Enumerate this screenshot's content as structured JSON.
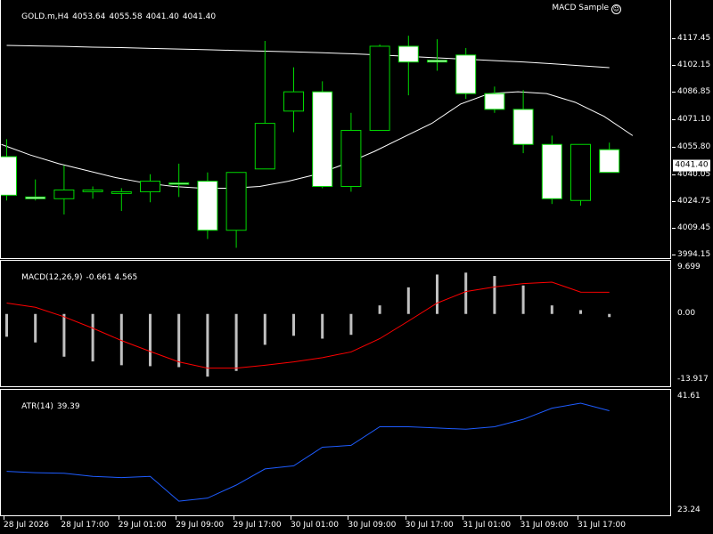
{
  "chart_data": [
    {
      "type": "candlestick",
      "header": {
        "symbol": "GOLD.m,H4",
        "open": "4053.64",
        "high": "4055.58",
        "low": "4041.40",
        "close": "4041.40"
      },
      "expert_name": "MACD Sample",
      "expert_icon": "smiley-icon",
      "current_price": "4041.40",
      "ylim": [
        3994.15,
        4127.2
      ],
      "yticks": [
        "4117.45",
        "4102.15",
        "4086.85",
        "4071.10",
        "4055.80",
        "4040.05",
        "4024.75",
        "4009.45",
        "3994.15"
      ],
      "candles": [
        {
          "o": 4050.0,
          "h": 4060.0,
          "l": 4025.0,
          "c": 4028.0
        },
        {
          "o": 4027.0,
          "h": 4037.0,
          "l": 4025.0,
          "c": 4026.0
        },
        {
          "o": 4026.0,
          "h": 4045.0,
          "l": 4017.0,
          "c": 4031.0
        },
        {
          "o": 4030.0,
          "h": 4033.0,
          "l": 4026.0,
          "c": 4031.0
        },
        {
          "o": 4029.0,
          "h": 4032.0,
          "l": 4019.0,
          "c": 4030.0
        },
        {
          "o": 4030.0,
          "h": 4040.0,
          "l": 4024.0,
          "c": 4036.0
        },
        {
          "o": 4035.0,
          "h": 4046.0,
          "l": 4027.0,
          "c": 4035.0
        },
        {
          "o": 4036.0,
          "h": 4041.0,
          "l": 4003.0,
          "c": 4008.0
        },
        {
          "o": 4008.0,
          "h": 4041.0,
          "l": 3998.0,
          "c": 4041.0
        },
        {
          "o": 4043.0,
          "h": 4116.0,
          "l": 4043.0,
          "c": 4069.0
        },
        {
          "o": 4076.0,
          "h": 4101.0,
          "l": 4064.0,
          "c": 4087.0
        },
        {
          "o": 4087.0,
          "h": 4093.0,
          "l": 4032.0,
          "c": 4033.0
        },
        {
          "o": 4033.0,
          "h": 4075.0,
          "l": 4030.0,
          "c": 4065.0
        },
        {
          "o": 4065.0,
          "h": 4114.0,
          "l": 4065.0,
          "c": 4113.0
        },
        {
          "o": 4113.0,
          "h": 4119.0,
          "l": 4085.0,
          "c": 4104.0
        },
        {
          "o": 4105.0,
          "h": 4117.0,
          "l": 4099.0,
          "c": 4104.0
        },
        {
          "o": 4108.0,
          "h": 4112.0,
          "l": 4083.0,
          "c": 4086.0
        },
        {
          "o": 4086.0,
          "h": 4090.0,
          "l": 4075.0,
          "c": 4077.0
        },
        {
          "o": 4077.0,
          "h": 4088.0,
          "l": 4052.0,
          "c": 4057.0
        },
        {
          "o": 4057.0,
          "h": 4062.0,
          "l": 4023.0,
          "c": 4026.0
        },
        {
          "o": 4025.0,
          "h": 4057.0,
          "l": 4022.0,
          "c": 4057.0
        },
        {
          "o": 4054.0,
          "h": 4058.0,
          "l": 4041.0,
          "c": 4041.0
        }
      ],
      "ma_slow": [
        4113.5,
        4113.2,
        4112.9,
        4112.5,
        4112.2,
        4111.8,
        4111.4,
        4111.0,
        4110.6,
        4110.2,
        4109.8,
        4109.3,
        4108.7,
        4108.0,
        4107.2,
        4106.4,
        4105.6,
        4104.8,
        4104.0,
        4103.0,
        4101.9,
        4100.8
      ],
      "ma_fast": [
        4057.0,
        4051.0,
        4046.0,
        4042.0,
        4038.0,
        4035.0,
        4033.0,
        4032.0,
        4032.0,
        4033.0,
        4036.0,
        4040.0,
        4046.0,
        4053.0,
        4061.0,
        4069.0,
        4080.0,
        4086.0,
        4087.0,
        4086.0,
        4081.0,
        4073.0,
        4062.0
      ]
    },
    {
      "type": "bar+line",
      "title": "MACD(12,26,9)",
      "values_text": "-0.661 4.565",
      "ylim": [
        -13.917,
        9.699
      ],
      "yticks": [
        "9.699",
        "0.00",
        "-13.917"
      ],
      "histogram": [
        -4.8,
        -6.0,
        -9.0,
        -10.0,
        -10.8,
        -11.0,
        -11.2,
        -13.2,
        -12.0,
        -6.5,
        -4.6,
        -5.2,
        -4.4,
        1.8,
        5.6,
        8.3,
        8.7,
        8.0,
        6.0,
        1.8,
        0.8,
        -0.661
      ],
      "signal": [
        2.3,
        1.4,
        -0.6,
        -3.0,
        -5.6,
        -7.9,
        -10.1,
        -11.4,
        -11.4,
        -10.8,
        -10.1,
        -9.2,
        -8.0,
        -5.2,
        -1.5,
        2.3,
        4.7,
        5.7,
        6.4,
        6.7,
        4.6,
        4.565
      ]
    },
    {
      "type": "line",
      "title": "ATR(14)",
      "values_text": "39.39",
      "ylim": [
        23.24,
        41.61
      ],
      "yticks": [
        "41.61",
        "23.24"
      ],
      "values": [
        29.6,
        29.4,
        29.3,
        28.8,
        28.6,
        28.8,
        24.8,
        25.3,
        27.4,
        30.0,
        30.5,
        33.5,
        33.8,
        36.8,
        36.8,
        36.6,
        36.4,
        36.8,
        38.0,
        39.8,
        40.6,
        39.39
      ]
    }
  ],
  "xaxis_labels": [
    "28 Jul 2026",
    "28 Jul 17:00",
    "29 Jul 01:00",
    "29 Jul 09:00",
    "29 Jul 17:00",
    "30 Jul 01:00",
    "30 Jul 09:00",
    "30 Jul 17:00",
    "31 Jul 01:00",
    "31 Jul 09:00",
    "31 Jul 17:00"
  ],
  "colors": {
    "bull_border": "#00d800",
    "bear_body": "#ffffff",
    "wick": "#00d800",
    "ma": "#ffffff",
    "macd_hist": "#c0c0c0",
    "macd_signal": "#ff0000",
    "atr": "#1e5cff",
    "background": "#000000",
    "frame": "#ffffff"
  }
}
